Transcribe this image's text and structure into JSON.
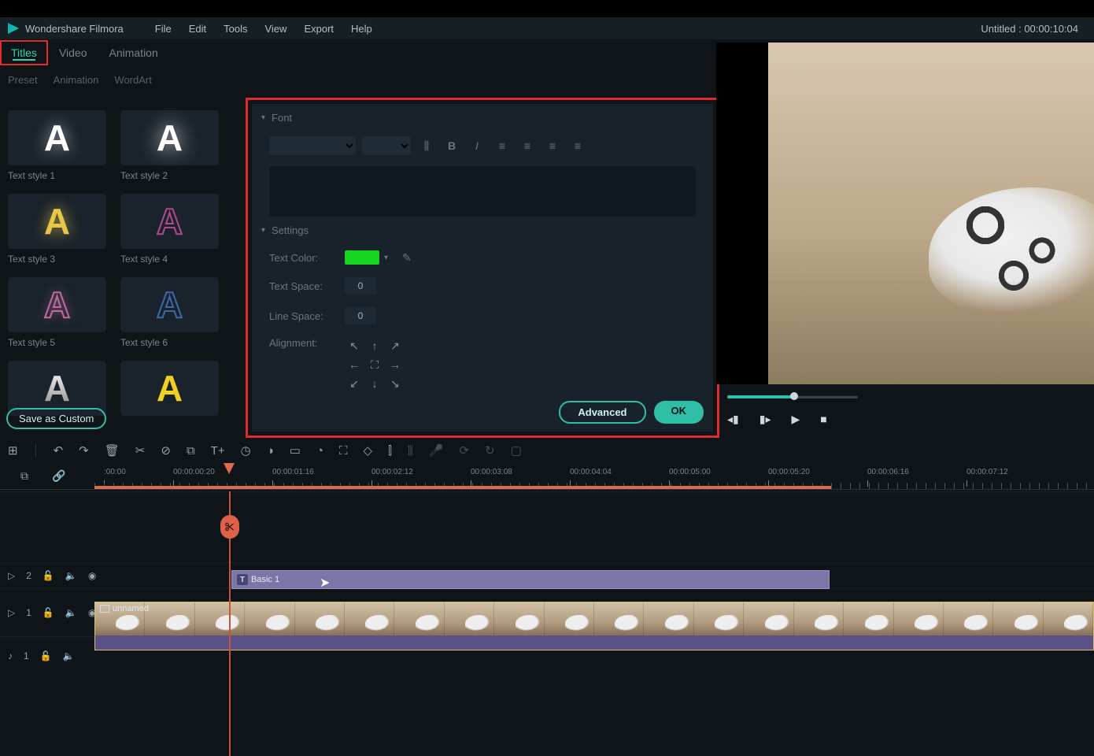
{
  "app": {
    "name": "Wondershare Filmora",
    "doc": "Untitled : 00:00:10:04"
  },
  "menu": {
    "file": "File",
    "edit": "Edit",
    "tools": "Tools",
    "view": "View",
    "export": "Export",
    "help": "Help"
  },
  "tabs": {
    "titles": "Titles",
    "video": "Video",
    "animation": "Animation"
  },
  "subtabs": {
    "preset": "Preset",
    "animation": "Animation",
    "wordart": "WordArt"
  },
  "styles": {
    "s1": "Text style 1",
    "s2": "Text style 2",
    "s3": "Text style 3",
    "s4": "Text style 4",
    "s5": "Text style 5",
    "s6": "Text style 6"
  },
  "saveCustom": "Save as Custom",
  "panel": {
    "font": "Font",
    "settings": "Settings",
    "textColor": "Text Color:",
    "textSpace": "Text Space:",
    "lineSpace": "Line Space:",
    "alignment": "Alignment:",
    "textSpaceVal": "0",
    "lineSpaceVal": "0",
    "advanced": "Advanced",
    "ok": "OK",
    "colorSwatch": "#17d421"
  },
  "ruler": {
    "t0": ":00:00",
    "t1": "00:00:00:20",
    "t2": "00:00:01:16",
    "t3": "00:00:02:12",
    "t4": "00:00:03:08",
    "t5": "00:00:04:04",
    "t6": "00:00:05:00",
    "t7": "00:00:05:20",
    "t8": "00:00:06:16",
    "t9": "00:00:07:12"
  },
  "clips": {
    "title": "Basic 1",
    "video": "unnamed"
  },
  "trackLabels": {
    "t1": "2",
    "t2": "1",
    "t3": "1"
  }
}
